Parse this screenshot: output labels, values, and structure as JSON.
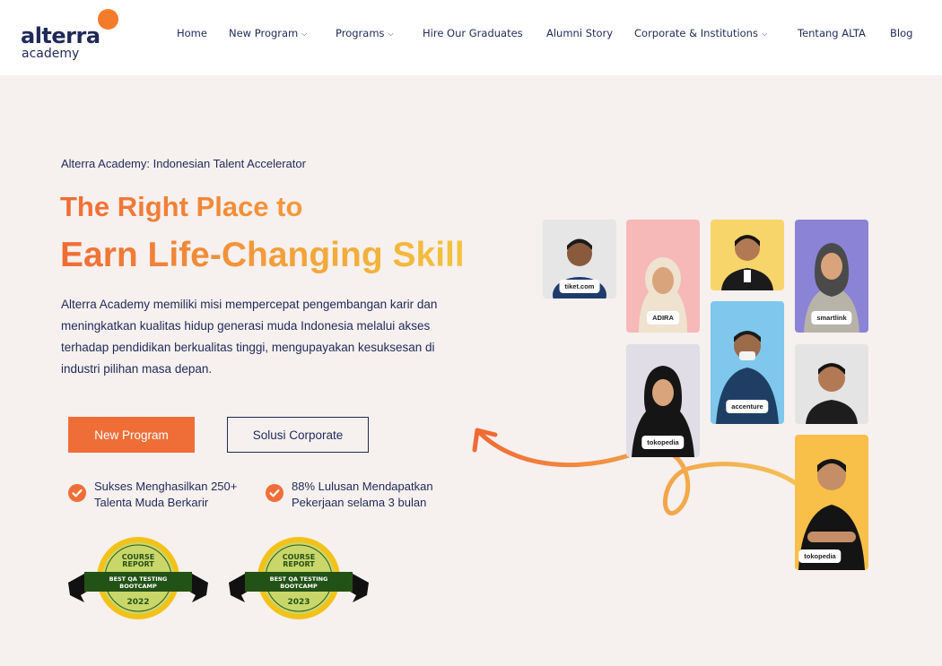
{
  "brand": {
    "name": "alterra",
    "sub": "academy",
    "accent": "#f47b2a",
    "navy": "#1f2a5a"
  },
  "nav": [
    {
      "label": "Home",
      "has_dropdown": false
    },
    {
      "label": "New Program",
      "has_dropdown": true
    },
    {
      "label": "Programs",
      "has_dropdown": true
    },
    {
      "label": "Hire Our Graduates",
      "has_dropdown": false
    },
    {
      "label": "Alumni Story",
      "has_dropdown": false
    },
    {
      "label": "Corporate & Institutions",
      "has_dropdown": true
    },
    {
      "label": "Tentang ALTA",
      "has_dropdown": false
    },
    {
      "label": "Blog",
      "has_dropdown": false
    }
  ],
  "hero": {
    "eyebrow": "Alterra Academy: Indonesian Talent Accelerator",
    "title_line1": "The Right Place to",
    "title_line2": "Earn Life-Changing Skill",
    "description": "Alterra Academy memiliki misi mempercepat pengembangan karir dan meningkatkan kualitas hidup generasi muda Indonesia melalui akses terhadap pendidikan berkualitas tinggi, mengupayakan kesuksesan di industri pilihan masa depan.",
    "primary_button": "New Program",
    "secondary_button": "Solusi Corporate"
  },
  "stats": [
    {
      "text": "Sukses Menghasilkan 250+ Talenta Muda Berkarir"
    },
    {
      "text": "88% Lulusan Mendapatkan Pekerjaan selama 3 bulan"
    }
  ],
  "badges": [
    {
      "top": "COURSE",
      "top2": "REPORT",
      "ribbon1": "BEST QA TESTING",
      "ribbon2": "BOOTCAMP",
      "year": "2022"
    },
    {
      "top": "COURSE",
      "top2": "REPORT",
      "ribbon1": "BEST QA TESTING",
      "ribbon2": "BOOTCAMP",
      "year": "2023"
    }
  ],
  "alumni_tiles": [
    {
      "bg": "#e6e6e6",
      "shirt": "#1f3b6e",
      "company": "tiket.com"
    },
    {
      "bg": "#f7b8b8",
      "shirt": "#efe2cf",
      "company": "ADIRA"
    },
    {
      "bg": "#f8d56b",
      "shirt": "#1b1b1b",
      "company": ""
    },
    {
      "bg": "#8b83d6",
      "shirt": "#b7b3a8",
      "company": "smartlink"
    },
    {
      "bg": "#e0dde6",
      "shirt": "#151515",
      "company": "tokopedia"
    },
    {
      "bg": "#7fc7ec",
      "shirt": "#1e3f63",
      "company": "accenture"
    },
    {
      "bg": "#e4e4e4",
      "shirt": "#1d1d1d",
      "company": ""
    },
    {
      "bg": "#f8c049",
      "shirt": "#141414",
      "company": "tokopedia"
    }
  ]
}
